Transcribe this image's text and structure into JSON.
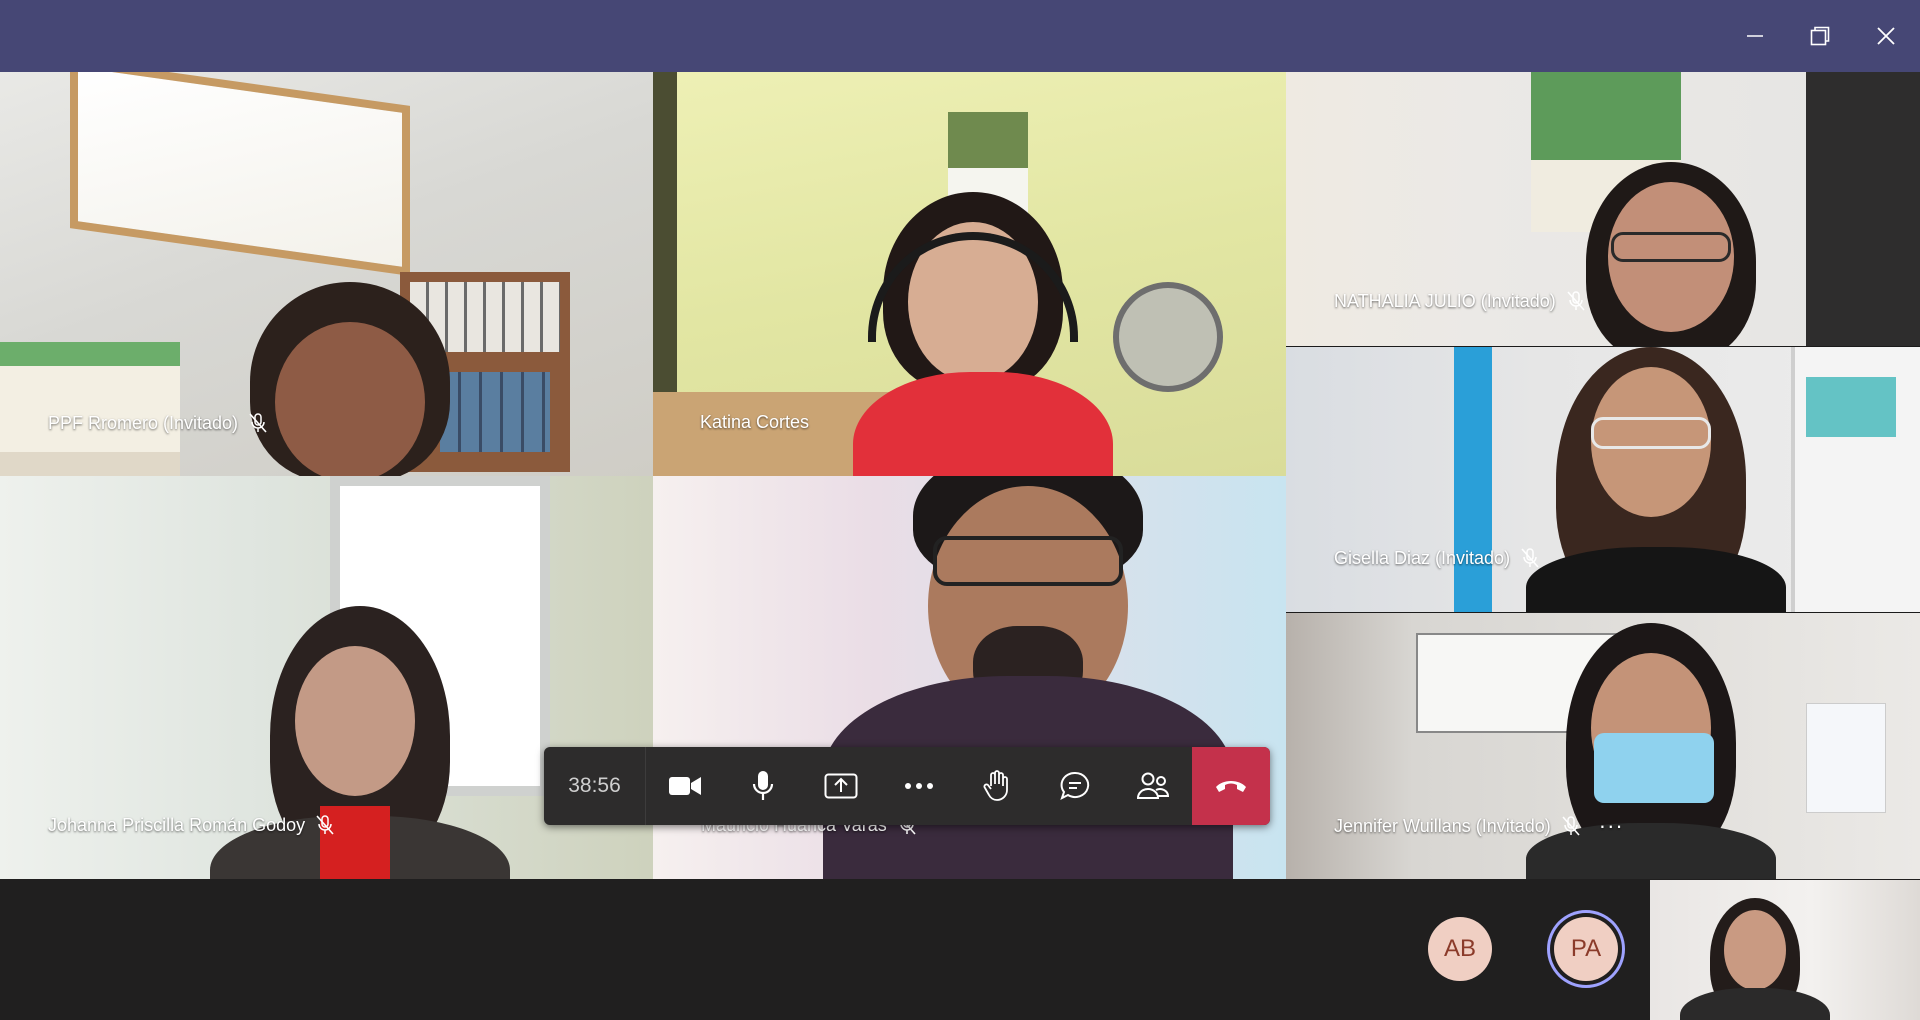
{
  "window": {
    "title_bar_color": "#464775",
    "minimize_icon": "minimize-icon",
    "restore_icon": "restore-icon",
    "close_icon": "close-icon"
  },
  "participants": [
    {
      "name": "PPF Rromero (Invitado)",
      "muted": true
    },
    {
      "name": "Katina Cortes",
      "muted": false
    },
    {
      "name": "NATHALIA JULIO (Invitado)",
      "muted": true
    },
    {
      "name": "Gisella Diaz (Invitado)",
      "muted": true
    },
    {
      "name": "Johanna Priscilla Román Godoy",
      "muted": true
    },
    {
      "name": "Mauricio Huanca Varas",
      "muted": true
    },
    {
      "name": "Jennifer Wuillans (Invitado)",
      "muted": true,
      "more": "···"
    }
  ],
  "controls": {
    "timer": "38:56",
    "camera_icon": "camera-icon",
    "mic_icon": "microphone-icon",
    "share_icon": "share-screen-icon",
    "more_icon": "more-actions-icon",
    "raise_hand_icon": "raise-hand-icon",
    "chat_icon": "chat-icon",
    "people_icon": "participants-icon",
    "hangup_icon": "hang-up-icon",
    "hangup_color": "#c4314b"
  },
  "bottom": {
    "avatars": [
      {
        "initials": "AB"
      },
      {
        "initials": "PA",
        "active_speaker": true
      }
    ]
  }
}
